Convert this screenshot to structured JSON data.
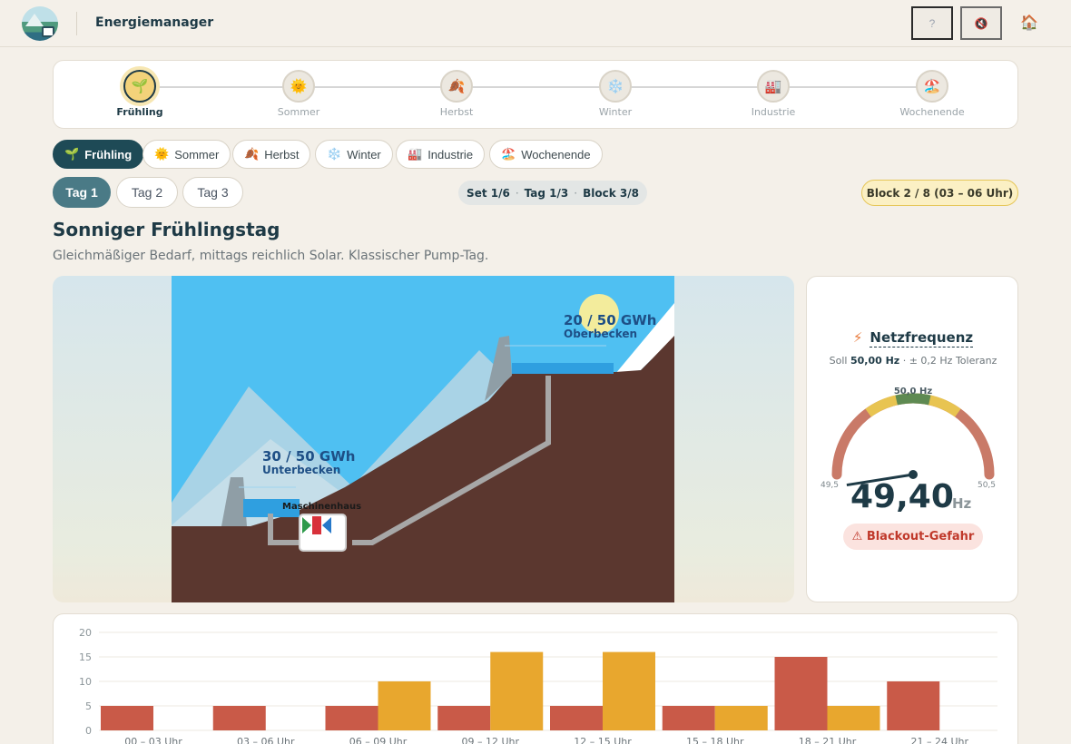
{
  "header": {
    "title": "Energiemanager",
    "help_button": "?",
    "mute_button": "🔇",
    "home_icon": "🏠"
  },
  "stepper": [
    {
      "label": "Frühling",
      "icon": "🌱",
      "active": true
    },
    {
      "label": "Sommer",
      "icon": "🌞",
      "active": false
    },
    {
      "label": "Herbst",
      "icon": "🍂",
      "active": false
    },
    {
      "label": "Winter",
      "icon": "❄️",
      "active": false
    },
    {
      "label": "Industrie",
      "icon": "🏭",
      "active": false
    },
    {
      "label": "Wochenende",
      "icon": "🏖️",
      "active": false
    }
  ],
  "season_pills": [
    {
      "label": "Frühling",
      "icon": "🌱",
      "active": true
    },
    {
      "label": "Sommer",
      "icon": "🌞",
      "active": false
    },
    {
      "label": "Herbst",
      "icon": "🍂",
      "active": false
    },
    {
      "label": "Winter",
      "icon": "❄️",
      "active": false
    },
    {
      "label": "Industrie",
      "icon": "🏭",
      "active": false
    },
    {
      "label": "Wochenende",
      "icon": "🏖️",
      "active": false
    }
  ],
  "day_tabs": [
    {
      "label": "Tag 1",
      "active": true
    },
    {
      "label": "Tag 2",
      "active": false
    },
    {
      "label": "Tag 3",
      "active": false
    }
  ],
  "progress": {
    "set": "Set 1/6",
    "day": "Tag 1/3",
    "block": "Block 3/8",
    "separator": "·"
  },
  "block_badge": "Block 2 / 8 (03 – 06 Uhr)",
  "scenario": {
    "title": "Sonniger Frühlingstag",
    "description": "Gleichmäßiger Bedarf, mittags reichlich Solar. Klassischer Pump-Tag."
  },
  "scene": {
    "upper": {
      "value": "20 / 50 GWh",
      "name": "Oberbecken",
      "fill": 0.4
    },
    "lower": {
      "value": "30 / 50 GWh",
      "name": "Unterbecken",
      "fill": 0.6
    },
    "powerhouse": "Maschinenhaus",
    "colors": {
      "sky": "#4fc0f2",
      "mountain": "#5b372f",
      "water": "#2f9fe0",
      "sun": "#f3ec9c"
    }
  },
  "frequency": {
    "title": "Netzfrequenz",
    "icon": "bolt-icon",
    "target_label": "Soll",
    "target_value": "50,00 Hz",
    "tolerance": "· ± 0,2 Hz Toleranz",
    "gauge_min": "49,5",
    "gauge_max": "50,5",
    "gauge_center": "50,0 Hz",
    "min": 49.5,
    "max": 50.5,
    "current": 49.4,
    "value": "49,40",
    "unit": "Hz",
    "status": "⚠ Blackout-Gefahr",
    "colors": {
      "danger": "#c97a68",
      "warn": "#e8c451",
      "ok": "#5e8a52",
      "needle": "#1e3a46"
    }
  },
  "chart_data": {
    "type": "bar",
    "categories": [
      "00 – 03 Uhr",
      "03 – 06 Uhr",
      "06 – 09 Uhr",
      "09 – 12 Uhr",
      "12 – 15 Uhr",
      "15 – 18 Uhr",
      "18 – 21 Uhr",
      "21 – 24 Uhr"
    ],
    "series": [
      {
        "values": [
          5,
          5,
          5,
          5,
          5,
          5,
          15,
          10
        ],
        "color": "#c95a48"
      },
      {
        "values": [
          0,
          0,
          10,
          16,
          16,
          5,
          5,
          0
        ],
        "color": "#e8a72e"
      }
    ],
    "ylim": [
      0,
      20
    ],
    "yticks": [
      0,
      5,
      10,
      15,
      20
    ],
    "grid": true
  }
}
